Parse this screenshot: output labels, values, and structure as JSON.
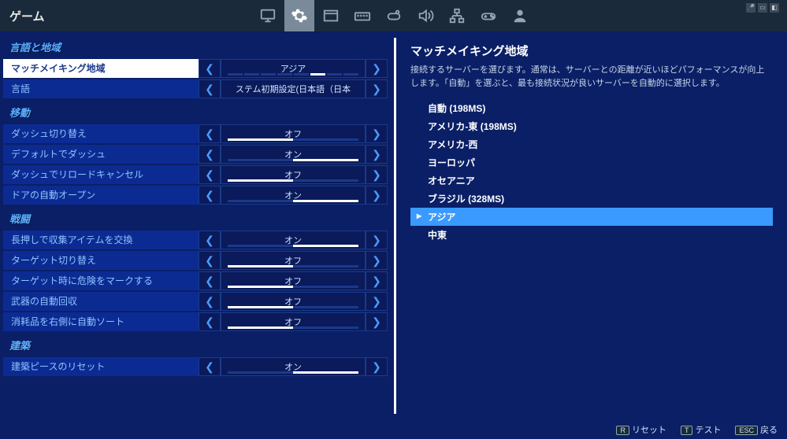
{
  "topbar": {
    "title": "ゲーム"
  },
  "sections": [
    {
      "header": "言語と地域",
      "rows": [
        {
          "label": "マッチメイキング地域",
          "value": "アジア",
          "selected": true,
          "bar_type": "dots"
        },
        {
          "label": "言語",
          "value": "ステム初期設定(日本語（日本",
          "bar_type": "none"
        }
      ]
    },
    {
      "header": "移動",
      "rows": [
        {
          "label": "ダッシュ切り替え",
          "value": "オフ",
          "fill": 0
        },
        {
          "label": "デフォルトでダッシュ",
          "value": "オン",
          "fill": 100
        },
        {
          "label": "ダッシュでリロードキャンセル",
          "value": "オフ",
          "fill": 0
        },
        {
          "label": "ドアの自動オープン",
          "value": "オン",
          "fill": 100
        }
      ]
    },
    {
      "header": "戦闘",
      "rows": [
        {
          "label": "長押しで収集アイテムを交換",
          "value": "オン",
          "fill": 100
        },
        {
          "label": "ターゲット切り替え",
          "value": "オフ",
          "fill": 0
        },
        {
          "label": "ターゲット時に危険をマークする",
          "value": "オフ",
          "fill": 0
        },
        {
          "label": "武器の自動回収",
          "value": "オフ",
          "fill": 0
        },
        {
          "label": "消耗品を右側に自動ソート",
          "value": "オフ",
          "fill": 0
        }
      ]
    },
    {
      "header": "建築",
      "rows": [
        {
          "label": "建築ピースのリセット",
          "value": "オン",
          "fill": 100
        }
      ]
    }
  ],
  "right": {
    "title": "マッチメイキング地域",
    "desc": "接続するサーバーを選びます。通常は、サーバーとの距離が近いほどパフォーマンスが向上します。「自動」を選ぶと、最も接続状況が良いサーバーを自動的に選択します。",
    "regions": [
      {
        "name": "自動 (198MS)"
      },
      {
        "name": "アメリカ-東 (198MS)"
      },
      {
        "name": "アメリカ-西"
      },
      {
        "name": "ヨーロッパ"
      },
      {
        "name": "オセアニア"
      },
      {
        "name": "ブラジル (328MS)"
      },
      {
        "name": "アジア",
        "selected": true
      },
      {
        "name": "中東"
      }
    ]
  },
  "footer": {
    "reset_key": "R",
    "reset_label": "リセット",
    "test_key": "T",
    "test_label": "テスト",
    "back_key": "ESC",
    "back_label": "戻る"
  }
}
